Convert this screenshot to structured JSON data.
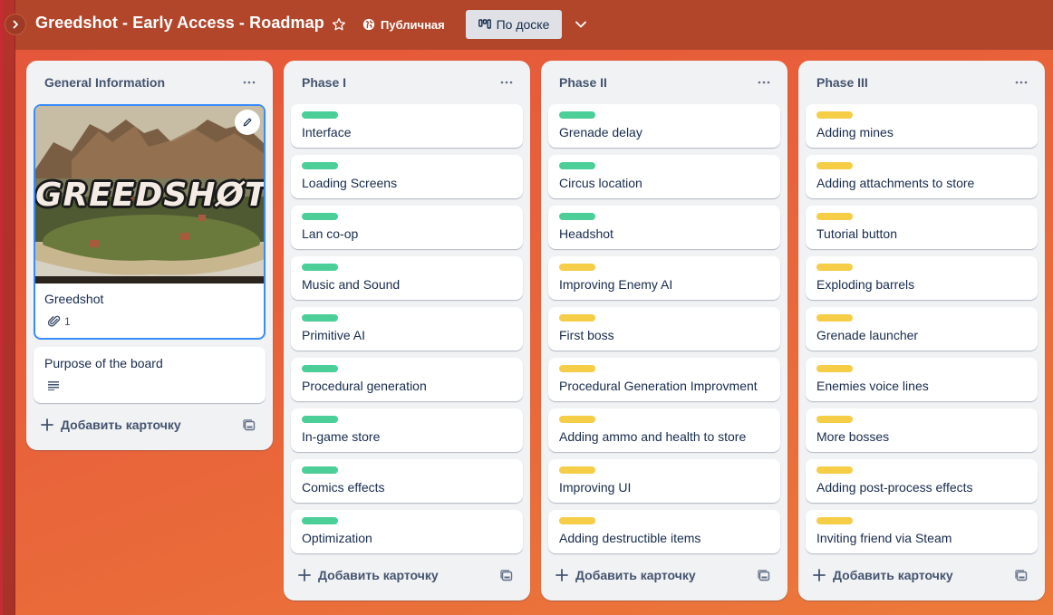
{
  "topbar": {
    "board_title": "Greedshot - Early Access - Roadmap",
    "visibility_label": "Публичная",
    "view_label": "По доске",
    "icons": {
      "expand": "chevron-right-icon",
      "star": "star-icon",
      "visibility": "globe-icon",
      "view": "board-view-icon",
      "view_dropdown": "chevron-down-icon"
    }
  },
  "colors": {
    "label_green": "#4bce97",
    "label_yellow": "#f5cd47",
    "topbar": "#b2462b",
    "view_button_bg": "#dfe1e6",
    "cover_border": "#388bff"
  },
  "lists": [
    {
      "title": "General Information",
      "add_card_label": "Добавить карточку",
      "cover_card": {
        "cover_text": "GREEDSHØT",
        "title": "Greedshot",
        "attachments": "1"
      },
      "cards": [
        {
          "title": "Purpose of the board",
          "has_description": true
        }
      ]
    },
    {
      "title": "Phase I",
      "add_card_label": "Добавить карточку",
      "cards": [
        {
          "title": "Interface",
          "label": "green"
        },
        {
          "title": "Loading Screens",
          "label": "green"
        },
        {
          "title": "Lan co-op",
          "label": "green"
        },
        {
          "title": "Music and Sound",
          "label": "green"
        },
        {
          "title": "Primitive AI",
          "label": "green"
        },
        {
          "title": "Procedural generation",
          "label": "green"
        },
        {
          "title": "In-game store",
          "label": "green"
        },
        {
          "title": "Comics effects",
          "label": "green"
        },
        {
          "title": "Optimization",
          "label": "green"
        }
      ]
    },
    {
      "title": "Phase II",
      "add_card_label": "Добавить карточку",
      "cards": [
        {
          "title": "Grenade delay",
          "label": "green"
        },
        {
          "title": "Circus location",
          "label": "green"
        },
        {
          "title": "Headshot",
          "label": "green"
        },
        {
          "title": "Improving Enemy AI",
          "label": "yellow"
        },
        {
          "title": "First boss",
          "label": "yellow"
        },
        {
          "title": "Procedural Generation Improvment",
          "label": "yellow"
        },
        {
          "title": "Adding ammo and health to store",
          "label": "yellow"
        },
        {
          "title": "Improving UI",
          "label": "yellow"
        },
        {
          "title": "Adding destructible items",
          "label": "yellow"
        }
      ]
    },
    {
      "title": "Phase III",
      "add_card_label": "Добавить карточку",
      "cards": [
        {
          "title": "Adding mines",
          "label": "yellow"
        },
        {
          "title": "Adding attachments to store",
          "label": "yellow"
        },
        {
          "title": "Tutorial button",
          "label": "yellow"
        },
        {
          "title": "Exploding barrels",
          "label": "yellow"
        },
        {
          "title": "Grenade launcher",
          "label": "yellow"
        },
        {
          "title": "Enemies voice lines",
          "label": "yellow"
        },
        {
          "title": "More bosses",
          "label": "yellow"
        },
        {
          "title": "Adding post-process effects",
          "label": "yellow"
        },
        {
          "title": "Inviting friend via Steam",
          "label": "yellow"
        }
      ]
    }
  ]
}
